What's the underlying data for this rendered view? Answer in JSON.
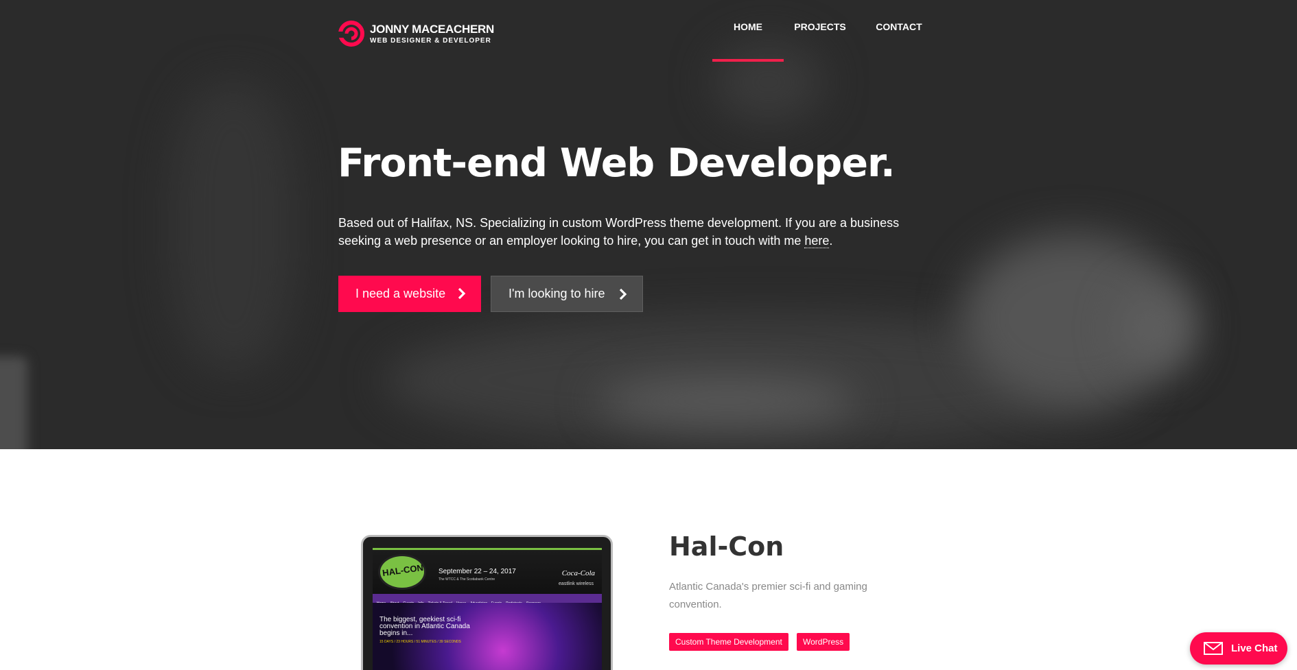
{
  "brand": {
    "name": "JONNY MACEACHERN",
    "tagline": "WEB DESIGNER & DEVELOPER",
    "accent": "#ff0a4e"
  },
  "nav": {
    "items": [
      {
        "label": "HOME",
        "active": true
      },
      {
        "label": "PROJECTS",
        "active": false
      },
      {
        "label": "CONTACT",
        "active": false
      }
    ]
  },
  "hero": {
    "title": "Front-end Web Developer.",
    "description": "Based out of Halifax, NS. Specializing in custom WordPress theme development. If you are a business seeking a web presence or an employer looking to hire, you can get in touch with me ",
    "link_text": "here",
    "description_end": ".",
    "primary_button": "I need a website",
    "secondary_button": "I'm looking to hire"
  },
  "project": {
    "title": "Hal-Con",
    "description": "Atlantic Canada's premier sci-fi and gaming convention.",
    "tags": [
      "Custom Theme Development",
      "WordPress"
    ],
    "screenshot": {
      "logo": "HAL-CON",
      "date": "September 22 – 24, 2017",
      "venue": "The WTCC & The Scotiabank Centre",
      "sponsor_label": "Presented by:",
      "sponsor": "Coca-Cola",
      "sponsor2": "eastlink wireless",
      "nav": [
        "Home",
        "About",
        "Guests",
        "Info",
        "Tickets & Travel",
        "Venue",
        "Advertising",
        "Events",
        "Participate",
        "Sponsors"
      ],
      "headline": "The biggest, geekiest sci-fi convention in Atlantic Canada begins in...",
      "countdown": "15 DAYS / 23 HOURS / 51 MINUTES / 39 SECONDS"
    }
  },
  "live_chat": {
    "label": "Live Chat"
  }
}
